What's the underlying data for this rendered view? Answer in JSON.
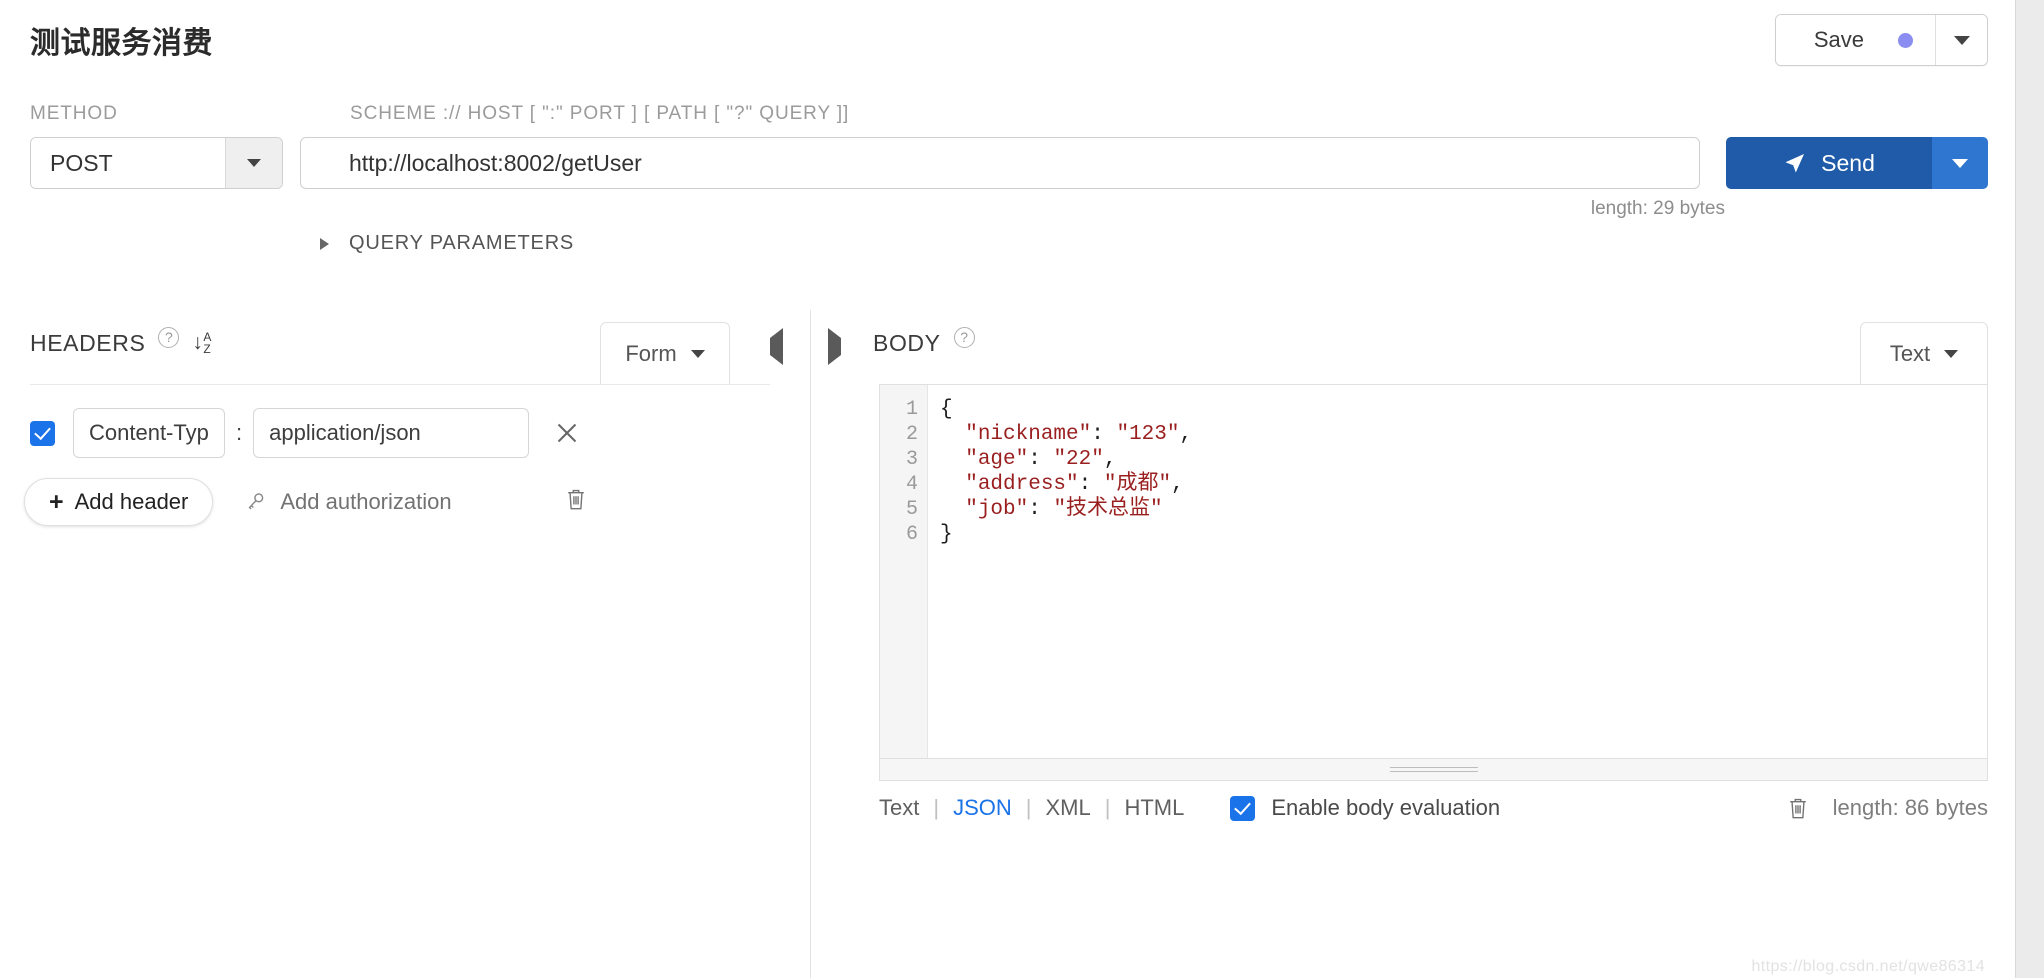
{
  "header": {
    "title": "测试服务消费",
    "save_label": "Save",
    "save_dot_color": "#8b8ef0",
    "save_caret_icon": "chevron-down-icon"
  },
  "request": {
    "method_label": "METHOD",
    "method_value": "POST",
    "url_label": "SCHEME :// HOST [ \":\" PORT ] [ PATH [ \"?\" QUERY ]]",
    "url_value": "http://localhost:8002/getUser",
    "send_label": "Send",
    "send_icon": "paper-plane-icon",
    "send_color": "#1f5ba8",
    "send_caret_color": "#2f76d0",
    "length": "length: 29 bytes",
    "query_parameters_label": "QUERY PARAMETERS",
    "query_parameters_icon": "triangle-right-icon"
  },
  "headers_panel": {
    "title": "HEADERS",
    "help_icon": "question-circle-icon",
    "sort_icon": "sort-az-icon",
    "sort_arrow": "↓",
    "sort_a": "A",
    "sort_z": "Z",
    "view_mode": "Form",
    "collapse_icon": "triangle-left-icon",
    "rows": [
      {
        "enabled": true,
        "key": "Content-Typ",
        "separator": ":",
        "value": "application/json",
        "remove_icon": "close-icon"
      }
    ],
    "add_header_label": "Add header",
    "add_header_icon": "plus-icon",
    "add_authorization_label": "Add authorization",
    "add_authorization_icon": "key-icon",
    "delete_icon": "trash-icon"
  },
  "body_panel": {
    "title": "BODY",
    "help_icon": "question-circle-icon",
    "expand_icon": "triangle-right-icon",
    "view_mode": "Text",
    "line_numbers": [
      "1",
      "2",
      "3",
      "4",
      "5",
      "6"
    ],
    "code_lines": [
      {
        "plain_before": "{",
        "string": "",
        "plain_after": ""
      },
      {
        "plain_before": "  ",
        "string": "\"nickname\"",
        "mid": ": ",
        "string2": "\"123\"",
        "plain_after": ","
      },
      {
        "plain_before": "  ",
        "string": "\"age\"",
        "mid": ": ",
        "string2": "\"22\"",
        "plain_after": ","
      },
      {
        "plain_before": "  ",
        "string": "\"address\"",
        "mid": ": ",
        "string2": "\"成都\"",
        "plain_after": ","
      },
      {
        "plain_before": "  ",
        "string": "\"job\"",
        "mid": ": ",
        "string2": "\"技术总监\"",
        "plain_after": ""
      },
      {
        "plain_before": "}",
        "string": "",
        "plain_after": ""
      }
    ],
    "formats": [
      "Text",
      "JSON",
      "XML",
      "HTML"
    ],
    "active_format": "JSON",
    "active_format_color": "#1a73e8",
    "enable_body_evaluation_label": "Enable body evaluation",
    "enable_body_evaluation_checked": true,
    "delete_icon": "trash-icon",
    "length": "length: 86 bytes"
  },
  "watermark": "https://blog.csdn.net/qwe86314"
}
